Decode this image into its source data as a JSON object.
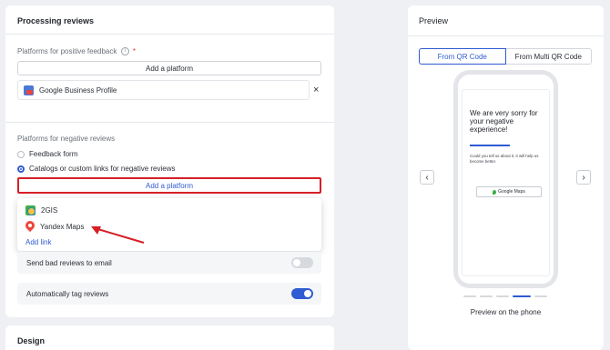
{
  "processing": {
    "title": "Processing reviews",
    "positive": {
      "label": "Platforms for positive feedback",
      "required_mark": "*",
      "add_button": "Add a platform",
      "platforms": [
        {
          "name": "Google Business Profile",
          "icon": "google-business-icon"
        }
      ],
      "remove_symbol": "×"
    },
    "negative": {
      "label": "Platforms for negative reviews",
      "options": [
        {
          "label": "Feedback form",
          "checked": false
        },
        {
          "label": "Catalogs or custom links for negative reviews",
          "checked": true
        }
      ],
      "add_button": "Add a platform",
      "dropdown": {
        "items": [
          {
            "label": "2GIS",
            "icon": "2gis-icon"
          },
          {
            "label": "Yandex Maps",
            "icon": "yandex-maps-icon"
          }
        ],
        "add_link": "Add link"
      }
    },
    "toggles": [
      {
        "label": "Send bad reviews to email",
        "on": false
      },
      {
        "label": "Automatically tag reviews",
        "on": true
      }
    ]
  },
  "design": {
    "title": "Design"
  },
  "preview": {
    "title": "Preview",
    "tabs": [
      {
        "label": "From QR Code",
        "active": true
      },
      {
        "label": "From Multi QR Code",
        "active": false
      }
    ],
    "prev_symbol": "‹",
    "next_symbol": "›",
    "phone": {
      "heading": "We are very sorry for your negative experience!",
      "body": "Could you tell us about it, it will help us become better.",
      "button": "Google Maps"
    },
    "carousel": {
      "count": 5,
      "active_index": 3
    },
    "caption": "Preview on the phone"
  },
  "colors": {
    "accent": "#2f5bd3",
    "highlight_border": "#d61f26",
    "annotation_arrow": "#d61f26"
  }
}
